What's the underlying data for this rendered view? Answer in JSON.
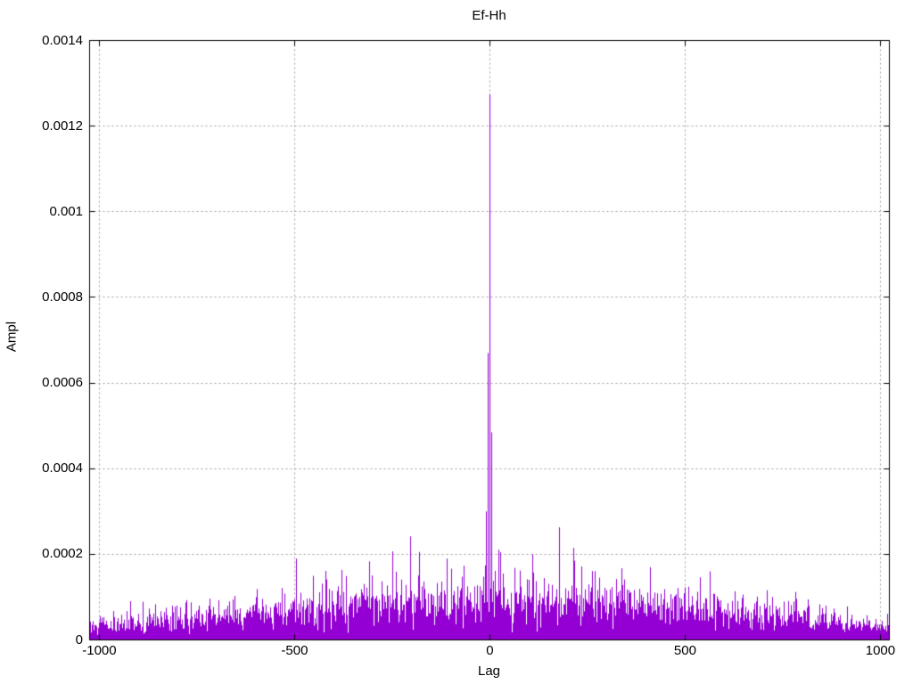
{
  "chart_data": {
    "type": "impulses",
    "title": "Ef-Hh",
    "xlabel": "Lag",
    "ylabel": "Ampl",
    "xlim": [
      -1025,
      1023
    ],
    "ylim": [
      0,
      0.0014
    ],
    "xticks": [
      {
        "value": -1000,
        "label": "-1000"
      },
      {
        "value": -500,
        "label": "-500"
      },
      {
        "value": 0,
        "label": "0"
      },
      {
        "value": 500,
        "label": "500"
      },
      {
        "value": 1000,
        "label": "1000"
      }
    ],
    "yticks": [
      {
        "value": 0,
        "label": "0"
      },
      {
        "value": 0.0002,
        "label": "0.0002"
      },
      {
        "value": 0.0004,
        "label": "0.0004"
      },
      {
        "value": 0.0006,
        "label": "0.0006"
      },
      {
        "value": 0.0008,
        "label": "0.0008"
      },
      {
        "value": 0.001,
        "label": "0.001"
      },
      {
        "value": 0.0012,
        "label": "0.0012"
      },
      {
        "value": 0.0014,
        "label": "0.0014"
      }
    ],
    "grid": true,
    "legend": "none",
    "line_color": "#9400d3",
    "grid_color": "#9e9e9e",
    "border_color": "#000000",
    "background_color": "#ffffff",
    "main_peaks": [
      {
        "x": -8,
        "y": 0.0003
      },
      {
        "x": -4,
        "y": 0.00067
      },
      {
        "x": 0,
        "y": 0.001275
      },
      {
        "x": 5,
        "y": 0.000485
      }
    ],
    "notable_spikes": [
      {
        "x": -495,
        "y": 0.00019
      },
      {
        "x": -203,
        "y": 0.000242
      },
      {
        "x": -110,
        "y": 0.00019
      },
      {
        "x": 27,
        "y": 0.000205
      },
      {
        "x": 110,
        "y": 0.0002
      },
      {
        "x": 178,
        "y": 0.000263
      },
      {
        "x": 215,
        "y": 0.000215
      },
      {
        "x": 410,
        "y": 0.00017
      },
      {
        "x": 563,
        "y": 0.00016
      }
    ],
    "noise": {
      "model": "rayleigh-impulse",
      "seed": 9,
      "lag_min": -1024,
      "lag_max": 1022,
      "sigma_edge": 3e-05,
      "sigma_center": 8.2e-05,
      "envelope_exponent": 1.4,
      "clip_max": 0.00028
    }
  }
}
